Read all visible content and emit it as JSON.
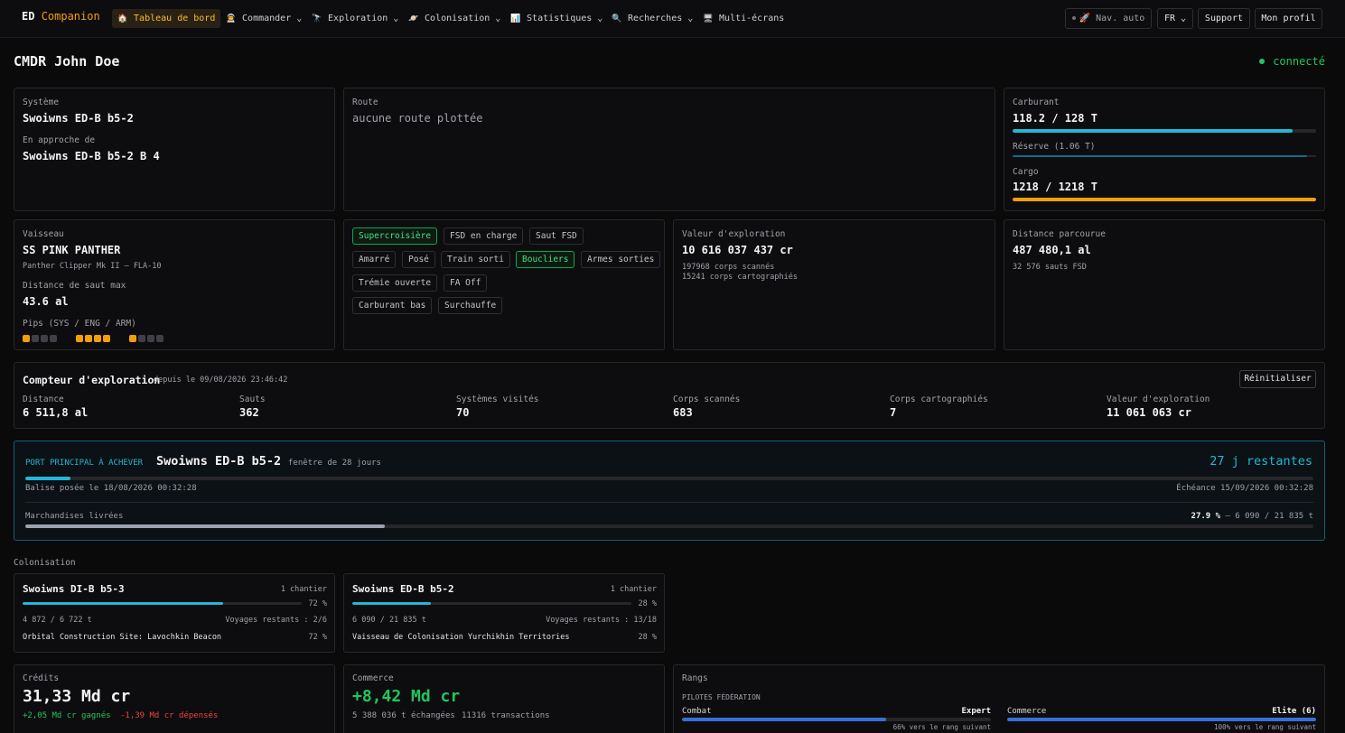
{
  "nav": {
    "brand_main": "ED",
    "brand_accent": "Companion",
    "items": [
      {
        "icon": "🏠",
        "label": "Tableau de bord"
      },
      {
        "icon": "👨‍🚀",
        "label": "Commander ⌄"
      },
      {
        "icon": "🔭",
        "label": "Exploration ⌄"
      },
      {
        "icon": "🪐",
        "label": "Colonisation ⌄"
      },
      {
        "icon": "📊",
        "label": "Statistiques ⌄"
      },
      {
        "icon": "🔍",
        "label": "Recherches ⌄"
      },
      {
        "icon": "🖥",
        "label": "Multi-écrans"
      }
    ],
    "nav_auto": "Nav. auto",
    "lang": "FR",
    "support": "Support",
    "profile": "Mon profil"
  },
  "header": {
    "cmdr": "CMDR John Doe",
    "status": "connecté",
    "status_color": "#22c55e"
  },
  "system": {
    "label": "Système",
    "value": "Swoiwns ED-B b5-2",
    "approach_label": "En approche de",
    "approach_value": "Swoiwns ED-B b5-2 B 4"
  },
  "route": {
    "label": "Route",
    "value": "aucune route plottée"
  },
  "fuel": {
    "label": "Carburant",
    "value": "118.2 / 128 T",
    "fraction": 0.923,
    "reserve_label": "Réserve (1.06 T)",
    "reserve_fraction": 0.97,
    "cargo_label": "Cargo",
    "cargo_value": "1218 / 1218 T",
    "cargo_fraction": 1.0
  },
  "ship": {
    "label": "Vaisseau",
    "name": "SS PINK PANTHER",
    "model": "Panther Clipper Mk II — FLA-10",
    "jump_label": "Distance de saut max",
    "jump_value": "43.6 al",
    "pips_label": "Pips (SYS / ENG / ARM)",
    "pips": [
      1,
      4,
      1
    ]
  },
  "flags": [
    {
      "label": "Supercroisière",
      "on": true
    },
    {
      "label": "FSD en charge",
      "on": false
    },
    {
      "label": "Saut FSD",
      "on": false
    },
    {
      "label": "Amarré",
      "on": false
    },
    {
      "label": "Posé",
      "on": false
    },
    {
      "label": "Train sorti",
      "on": false
    },
    {
      "label": "Boucliers",
      "on": true
    },
    {
      "label": "Armes sorties",
      "on": false
    },
    {
      "label": "Trémie ouverte",
      "on": false
    },
    {
      "label": "FA Off",
      "on": false
    },
    {
      "label": "Carburant bas",
      "on": false
    },
    {
      "label": "Surchauffe",
      "on": false
    }
  ],
  "exploration_value": {
    "label": "Valeur d'exploration",
    "value": "10 616 037 437 cr",
    "line1": "197968 corps scannés",
    "line2": "15241 corps cartographiés"
  },
  "distance": {
    "label": "Distance parcourue",
    "value": "487 480,1 al",
    "sub": "32 576 sauts FSD"
  },
  "counter": {
    "title": "Compteur d'exploration",
    "since": "depuis le 09/08/2026 23:46:42",
    "reset": "Réinitialiser",
    "stats": [
      {
        "label": "Distance",
        "value": "6 511,8 al"
      },
      {
        "label": "Sauts",
        "value": "362"
      },
      {
        "label": "Systèmes visités",
        "value": "70"
      },
      {
        "label": "Corps scannés",
        "value": "683"
      },
      {
        "label": "Corps cartographiés",
        "value": "7"
      },
      {
        "label": "Valeur d'exploration",
        "value": "11 061 063 cr"
      }
    ]
  },
  "port": {
    "tag": "PORT PRINCIPAL À ACHEVER",
    "name": "Swoiwns ED-B b5-2",
    "window": "fenêtre de 28 jours",
    "remaining": "27 j restantes",
    "time_fraction": 0.035,
    "beacon": "Balise posée le 18/08/2026 00:32:28",
    "deadline": "Échéance 15/09/2026 00:32:28",
    "goods_label": "Marchandises livrées",
    "goods_pct": "27.9 %",
    "goods_detail": " — 6 090 / 21 835 t",
    "goods_fraction": 0.279
  },
  "colonisation": {
    "label": "Colonisation",
    "sites": [
      {
        "name": "Swoiwns DI-B b5-3",
        "count": "1 chantier",
        "pct": "72 %",
        "fraction": 0.72,
        "tonnage": "4 872 / 6 722 t",
        "trips": "Voyages restants : 2/6",
        "site": "Orbital Construction Site: Lavochkin Beacon",
        "site_pct": "72 %"
      },
      {
        "name": "Swoiwns ED-B b5-2",
        "count": "1 chantier",
        "pct": "28 %",
        "fraction": 0.28,
        "tonnage": "6 090 / 21 835 t",
        "trips": "Voyages restants : 13/18",
        "site": "Vaisseau de Colonisation Yurchikhin Territories",
        "site_pct": "28 %"
      }
    ]
  },
  "credits": {
    "label": "Crédits",
    "value": "31,33 Md cr",
    "gained": "+2,05 Md cr gagnés",
    "spent": "-1,39 Md cr dépensés"
  },
  "commerce": {
    "label": "Commerce",
    "value": "+8,42 Md cr",
    "tonnes": "5 388 036 t échangées",
    "transactions": "11316 transactions"
  },
  "ranks": {
    "label": "Rangs",
    "group": "PILOTES FÉDÉRATION",
    "items": [
      {
        "name": "Combat",
        "rank": "Expert",
        "fraction": 0.66,
        "progress": "66% vers le rang suivant"
      },
      {
        "name": "Commerce",
        "rank": "Elite (6)",
        "fraction": 1.0,
        "progress": "100% vers le rang suivant"
      }
    ]
  },
  "colors": {
    "accent": "#f59e0b",
    "cyan": "#22b8d8",
    "green": "#22c55e",
    "red": "#ef4444",
    "rank_blue": "#3b6fd8"
  }
}
